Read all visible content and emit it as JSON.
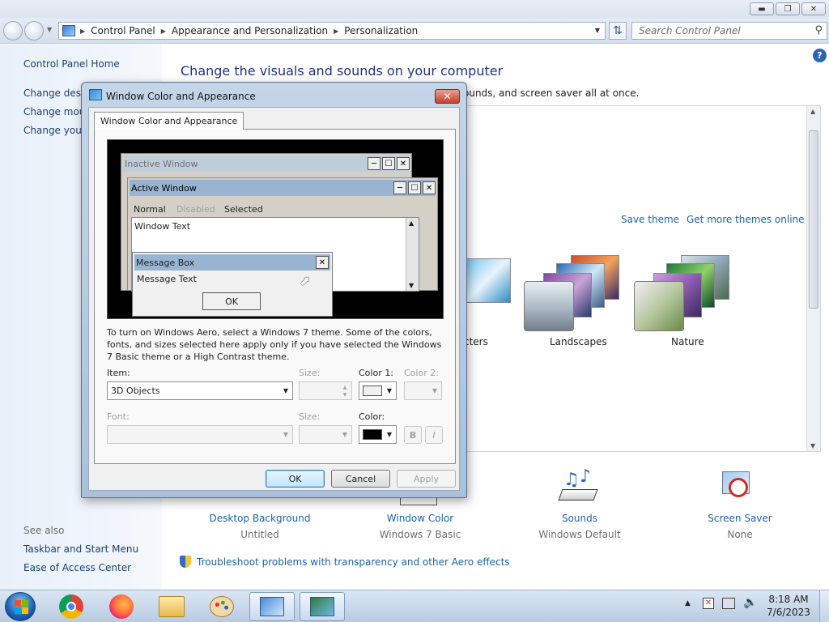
{
  "address": {
    "crumbs": [
      "Control Panel",
      "Appearance and Personalization",
      "Personalization"
    ],
    "search_placeholder": "Search Control Panel"
  },
  "left_nav": {
    "home": "Control Panel Home",
    "items": [
      "Change deskt",
      "Change mous",
      "Change your"
    ],
    "see_also_label": "See also",
    "see_also": [
      "Taskbar and Start Menu",
      "Ease of Access Center"
    ]
  },
  "main": {
    "heading": "Change the visuals and sounds on your computer",
    "subtext": "ounds, and screen saver all at once.",
    "save_theme": "Save theme",
    "get_more": "Get more themes online",
    "themes": [
      "cters",
      "Landscapes",
      "Nature"
    ],
    "bottom": [
      {
        "title": "Desktop Background",
        "sub": "Untitled"
      },
      {
        "title": "Window Color",
        "sub": "Windows 7 Basic"
      },
      {
        "title": "Sounds",
        "sub": "Windows Default"
      },
      {
        "title": "Screen Saver",
        "sub": "None"
      }
    ],
    "troubleshoot": "Troubleshoot problems with transparency and other Aero effects"
  },
  "dialog": {
    "title": "Window Color and Appearance",
    "tab": "Window Color and Appearance",
    "preview": {
      "inactive": "Inactive Window",
      "active": "Active Window",
      "menu": [
        "Normal",
        "Disabled",
        "Selected"
      ],
      "window_text": "Window Text",
      "msgbox_title": "Message Box",
      "msgbox_text": "Message Text",
      "ok": "OK"
    },
    "info": "To turn on Windows Aero, select a Windows 7 theme.  Some of the colors, fonts, and sizes selected here apply only if you have selected the Windows 7 Basic theme or a High Contrast theme.",
    "item_label": "Item:",
    "item_value": "3D Objects",
    "size_label": "Size:",
    "color1_label": "Color 1:",
    "color2_label": "Color 2:",
    "font_label": "Font:",
    "size2_label": "Size:",
    "color_label": "Color:",
    "bold": "B",
    "italic": "I",
    "buttons": {
      "ok": "OK",
      "cancel": "Cancel",
      "apply": "Apply"
    }
  },
  "taskbar": {
    "time": "8:18 AM",
    "date": "7/6/2023"
  },
  "colors": {
    "link": "#1e62a8",
    "heading": "#1e3287",
    "color1_swatch": "#f0f0f0",
    "color_swatch": "#000000",
    "preview_inactive_title": "#bfcddb",
    "preview_active_title": "#99b4d1"
  }
}
